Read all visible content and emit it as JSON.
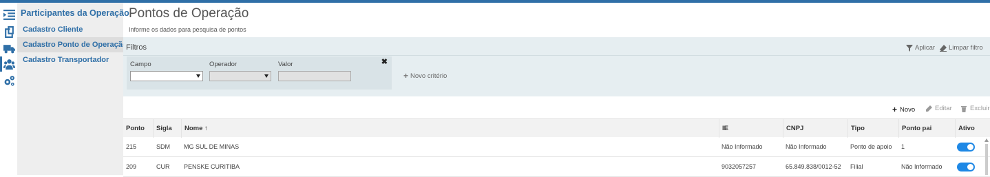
{
  "colors": {
    "accent": "#2f6fa7",
    "toggle_on": "#1e88e5",
    "filter_bg": "#e6eef1"
  },
  "iconbar": [
    {
      "icon": "menu-toggle-icon"
    },
    {
      "icon": "documents-icon"
    },
    {
      "icon": "truck-icon"
    },
    {
      "icon": "users-icon"
    },
    {
      "icon": "settings-icon"
    }
  ],
  "sidebar": {
    "title": "Participantes da Operação",
    "items": [
      {
        "label": "Cadastro Cliente"
      },
      {
        "label": "Cadastro Ponto de Operação",
        "active": true
      },
      {
        "label": "Cadastro Transportador"
      }
    ]
  },
  "page": {
    "title": "Pontos de Operação",
    "subtitle": "Informe os dados para pesquisa de pontos"
  },
  "filters": {
    "label": "Filtros",
    "apply_label": "Aplicar",
    "clear_label": "Limpar filtro",
    "criterion": {
      "field_label": "Campo",
      "operator_label": "Operador",
      "value_label": "Valor",
      "field_value": "",
      "operator_value": "",
      "value_value": ""
    },
    "new_criterion_label": "Novo critério"
  },
  "toolbar": {
    "new_label": "Novo",
    "edit_label": "Editar",
    "delete_label": "Excluir"
  },
  "table": {
    "columns": [
      "Ponto",
      "Sigla",
      "Nome ↑",
      "IE",
      "CNPJ",
      "Tipo",
      "Ponto pai",
      "Ativo"
    ],
    "rows": [
      {
        "ponto": "215",
        "sigla": "SDM",
        "nome": "MG SUL DE MINAS",
        "ie": "Não Informado",
        "cnpj": "Não Informado",
        "tipo": "Ponto de apoio",
        "ponto_pai": "1",
        "ativo": true
      },
      {
        "ponto": "209",
        "sigla": "CUR",
        "nome": "PENSKE CURITIBA",
        "ie": "9032057257",
        "cnpj": "65.849.838/0012-52",
        "tipo": "Filial",
        "ponto_pai": "Não Informado",
        "ativo": true
      }
    ]
  }
}
